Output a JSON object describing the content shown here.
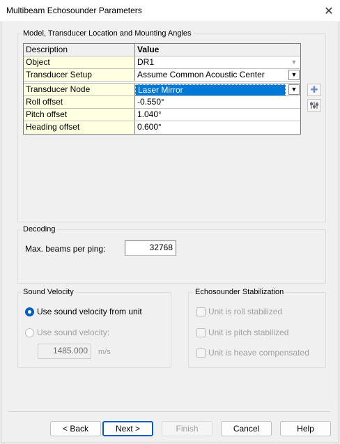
{
  "window": {
    "title": "Multibeam Echosounder Parameters",
    "close_icon": "close-icon"
  },
  "model_group": {
    "label": "Model, Transducer Location and Mounting Angles",
    "header": {
      "desc": "Description",
      "value": "Value"
    },
    "rows": [
      {
        "desc": "Object",
        "value": "DR1"
      },
      {
        "desc": "Transducer Setup",
        "value": "Assume Common Acoustic Center"
      },
      {
        "desc": "Transducer Node",
        "value": "Laser Mirror"
      },
      {
        "desc": "Roll offset",
        "value": "-0.550°"
      },
      {
        "desc": "Pitch offset",
        "value": "1.040°"
      },
      {
        "desc": "Heading offset",
        "value": "0.600°"
      }
    ]
  },
  "decoding": {
    "label": "Decoding",
    "max_beams_label": "Max.  beams per ping:",
    "max_beams_value": "32768"
  },
  "sound_velocity": {
    "label": "Sound Velocity",
    "from_unit_label": "Use sound velocity from unit",
    "use_label": "Use sound velocity:",
    "value": "1485.000",
    "unit": "m/s"
  },
  "stabilization": {
    "label": "Echosounder Stabilization",
    "roll": "Unit is roll stabilized",
    "pitch": "Unit is pitch stabilized",
    "heave": "Unit is heave compensated"
  },
  "buttons": {
    "back": "< Back",
    "next": "Next >",
    "finish": "Finish",
    "cancel": "Cancel",
    "help": "Help"
  }
}
